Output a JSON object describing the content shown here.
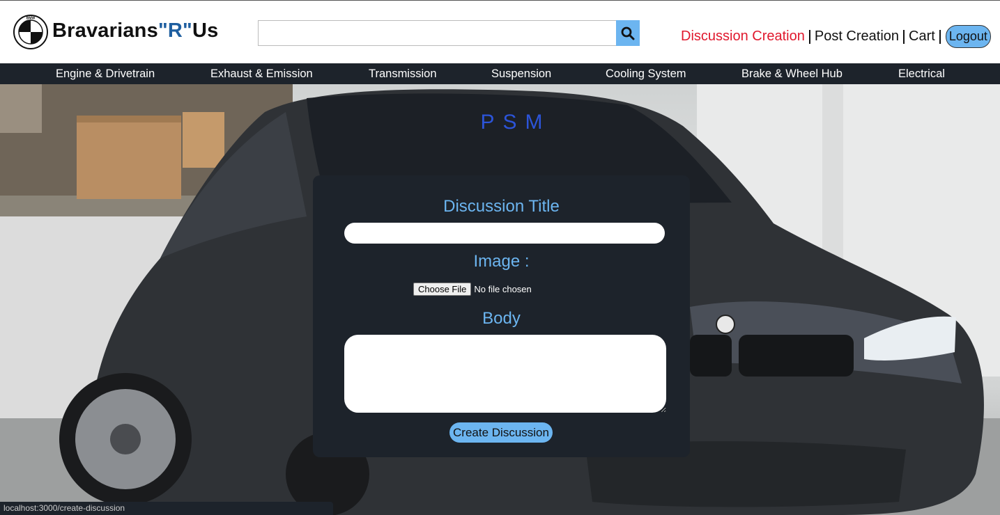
{
  "header": {
    "brand_main": "Bravarians",
    "brand_accent": "\"R\"",
    "brand_end": "Us",
    "logo_icon": "bmw-roundel-icon",
    "search": {
      "value": "",
      "placeholder": "",
      "button_icon": "search-icon"
    },
    "links": {
      "discussion_creation": "Discussion Creation",
      "post_creation": "Post Creation",
      "cart": "Cart",
      "logout": "Logout"
    }
  },
  "nav": {
    "items": [
      "Engine & Drivetrain",
      "Exhaust & Emission",
      "Transmission",
      "Suspension",
      "Cooling System",
      "Brake & Wheel Hub",
      "Electrical"
    ]
  },
  "hero": {
    "windshield_text": "PSM"
  },
  "form": {
    "title_label": "Discussion Title",
    "title_value": "",
    "image_label": "Image :",
    "file_button": "Choose File",
    "file_status": "No file chosen",
    "body_label": "Body",
    "body_value": "",
    "submit_label": "Create Discussion"
  },
  "status_bar": {
    "url": "localhost:3000/create-discussion"
  },
  "colors": {
    "accent_blue": "#6cb5f0",
    "active_red": "#e0182d",
    "dark_panel": "#1d232b",
    "brand_blue": "#1f5fa0"
  }
}
